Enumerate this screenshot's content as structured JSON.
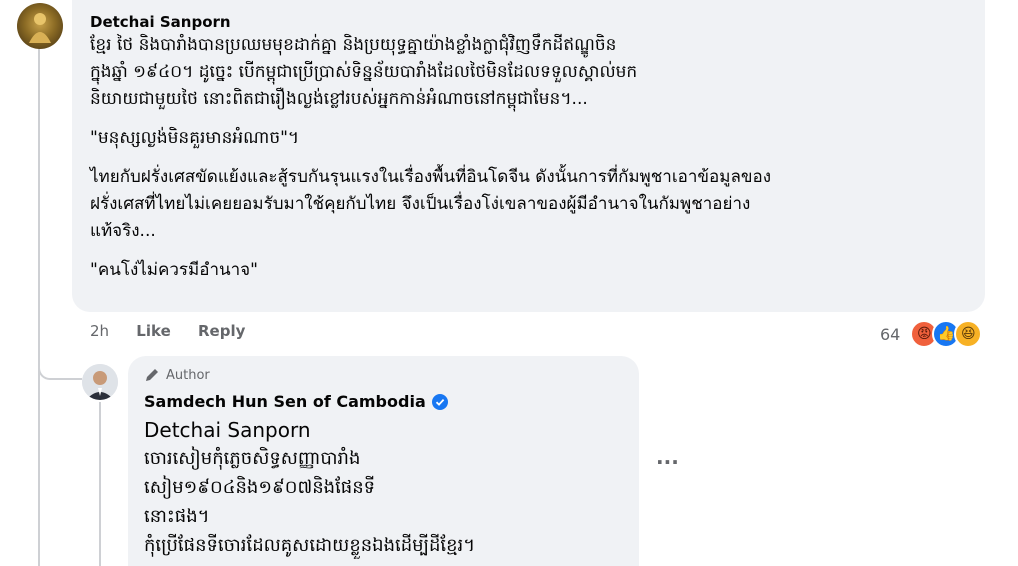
{
  "comment1": {
    "author": "Detchai Sanporn",
    "paragraphs": [
      [
        "ខ្មែរ ថៃ និងបារាំងបានប្រឈមមុខដាក់គ្នា និងប្រយុទ្ធគ្នាយ៉ាងខ្លាំងក្លាជុំវិញទឹកដីឥណ្ឌូចិន",
        "ក្នុងឆ្នាំ ១៩៤០។ ដូច្នេះ បើកម្ពុជាប្រើប្រាស់ទិន្នន័យបារាំងដែលថៃមិនដែលទទួលស្គាល់មក",
        "និយាយជាមួយថៃ នោះពិតជារឿងល្ងង់ខ្លៅរបស់អ្នកកាន់អំណាចនៅកម្ពុជាមែន។..."
      ],
      [
        "\"មនុស្សល្ងង់មិនគួរមានអំណាច\"។"
      ],
      [
        "ไทยกับฝรั่งเศสขัดแย้งและสู้รบกันรุนแรงในเรื่องพื้นที่อินโดจีน ดังนั้นการที่กัมพูชาเอาข้อมูลของ",
        "ฝรั่งเศสที่ไทยไม่เคยยอมรับมาใช้คุยกับไทย จึงเป็นเรื่องโง่เขลาของผู้มีอำนาจในกัมพูชาอย่าง",
        "แท้จริง..."
      ],
      [
        "\"คนโง่ไม่ควรมีอำนาจ\""
      ]
    ],
    "time": "2h",
    "like_label": "Like",
    "reply_label": "Reply",
    "reaction_count": "64"
  },
  "reply1": {
    "badge": "Author",
    "author": "Samdech Hun Sen of Cambodia",
    "mention": "Detchai Sanporn",
    "lines": [
      "ចោរសៀមកុំភ្លេចសិទ្ធសញ្ញាបារាំង",
      "សៀម១៩០៤និង១៩០៧និងផែនទី",
      "នោះផង។",
      "កុំប្រើផែនទីចោរដែលគូសដោយខ្លួនឯងដើម្បីដីខ្មែរ។"
    ],
    "more_label": "···"
  },
  "colors": {
    "bubble": "#f0f2f5",
    "verified": "#1877f2",
    "angry": "#f0603c",
    "like": "#1877f2",
    "haha": "#f7b125"
  }
}
